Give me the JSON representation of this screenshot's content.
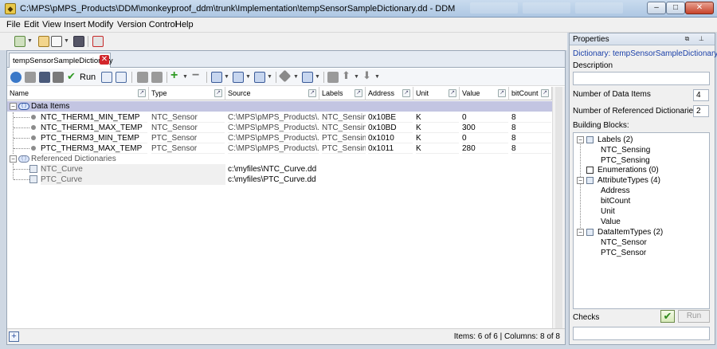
{
  "window": {
    "title": "C:\\MPS\\pMPS_Products\\DDM\\monkeyproof_ddm\\trunk\\Implementation\\tempSensorSampleDictionary.dd - DDM",
    "min_symbol": "–",
    "max_symbol": "□",
    "close_symbol": "✕"
  },
  "menu": [
    "File",
    "Edit",
    "View",
    "Insert",
    "Modify",
    "Version Control",
    "Help"
  ],
  "editor": {
    "tab_label": "tempSensorSampleDictionary",
    "tab_close": "✕",
    "run_label": "Run"
  },
  "table": {
    "columns": [
      "Name",
      "Type",
      "Source",
      "Labels",
      "Address",
      "Unit",
      "Value",
      "bitCount"
    ],
    "group_data_items": "Data Items",
    "data_items": [
      {
        "name": "NTC_THERM1_MIN_TEMP",
        "type": "NTC_Sensor",
        "source": "C:\\MPS\\pMPS_Products\\...",
        "labels": "NTC_Sensing",
        "address": "0x10BE",
        "unit": "K",
        "value": "0",
        "bitcount": "8"
      },
      {
        "name": "NTC_THERM1_MAX_TEMP",
        "type": "NTC_Sensor",
        "source": "C:\\MPS\\pMPS_Products\\...",
        "labels": "NTC_Sensing",
        "address": "0x10BD",
        "unit": "K",
        "value": "300",
        "bitcount": "8"
      },
      {
        "name": "PTC_THERM3_MIN_TEMP",
        "type": "PTC_Sensor",
        "source": "C:\\MPS\\pMPS_Products\\...",
        "labels": "PTC_Sensing",
        "address": "0x1010",
        "unit": "K",
        "value": "0",
        "bitcount": "8"
      },
      {
        "name": "PTC_THERM3_MAX_TEMP",
        "type": "PTC_Sensor",
        "source": "C:\\MPS\\pMPS_Products\\...",
        "labels": "PTC_Sensing",
        "address": "0x1011",
        "unit": "K",
        "value": "280",
        "bitcount": "8"
      }
    ],
    "group_ref_dicts": "Referenced Dictionaries",
    "ref_dicts": [
      {
        "name": "NTC_Curve",
        "source": "c:\\myfiles\\NTC_Curve.dd"
      },
      {
        "name": "PTC_Curve",
        "source": "c:\\myfiles\\PTC_Curve.dd"
      }
    ]
  },
  "status": {
    "text": "Items: 6 of 6 | Columns: 8 of 8",
    "add_symbol": "+"
  },
  "properties": {
    "header": "Properties",
    "dict_title": "Dictionary: tempSensorSampleDictionary",
    "description_label": "Description",
    "num_data_items_label": "Number of Data Items",
    "num_data_items": "4",
    "num_ref_dicts_label": "Number of Referenced Dictionaries",
    "num_ref_dicts": "2",
    "building_blocks_label": "Building Blocks:",
    "building_blocks": {
      "labels_title": "Labels (2)",
      "labels": [
        "NTC_Sensing",
        "PTC_Sensing"
      ],
      "enumerations_title": "Enumerations (0)",
      "attr_title": "AttributeTypes (4)",
      "attrs": [
        "Address",
        "bitCount",
        "Unit",
        "Value"
      ],
      "dit_title": "DataItemTypes (2)",
      "dits": [
        "NTC_Sensor",
        "PTC_Sensor"
      ]
    },
    "checks_label": "Checks",
    "checks_ok_symbol": "✔",
    "run_label": "Run"
  },
  "colors": {
    "group_row": "#c3c5e2",
    "link_title": "#1a3fa8",
    "tab_close": "#d2262b"
  }
}
